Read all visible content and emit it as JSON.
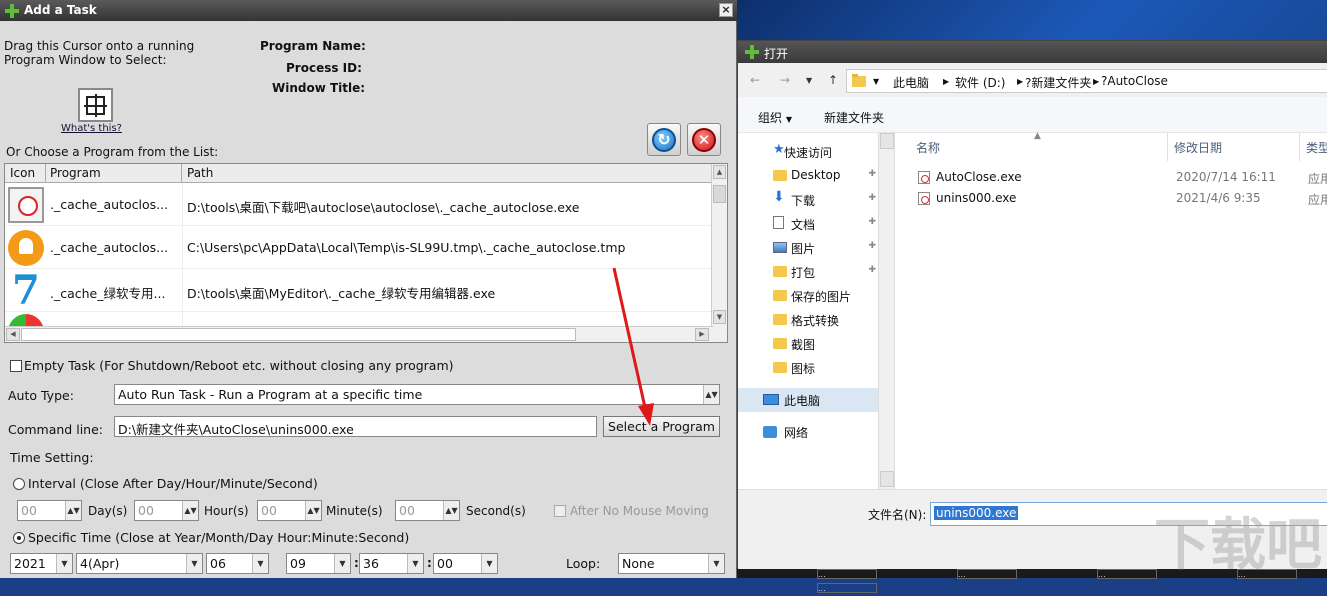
{
  "desktop": {
    "taskbar_items": [
      "...",
      "...",
      "...",
      "...",
      "..."
    ]
  },
  "add_task": {
    "title": "Add a Task",
    "drag_hint_line1": "Drag this Cursor onto a running",
    "drag_hint_line2": "Program Window to Select:",
    "whats_this": "What's this?",
    "program_name_label": "Program Name:",
    "process_id_label": "Process ID:",
    "window_title_label": "Window Title:",
    "choose_label": "Or Choose a Program from the List:",
    "columns": {
      "icon": "Icon",
      "program": "Program",
      "path": "Path"
    },
    "programs": [
      {
        "icon": "clock-icon",
        "name": "._cache_autoclos...",
        "path": "D:\\tools\\桌面\\下载吧\\autoclose\\autoclose\\._cache_autoclose.exe"
      },
      {
        "icon": "bell-icon",
        "name": "._cache_autoclos...",
        "path": "C:\\Users\\pc\\AppData\\Local\\Temp\\is-SL99U.tmp\\._cache_autoclose.tmp"
      },
      {
        "icon": "seven-icon",
        "name": "._cache_绿软专用...",
        "path": "D:\\tools\\桌面\\MyEditor\\._cache_绿软专用编辑器.exe"
      }
    ],
    "empty_task_label": "Empty Task (For Shutdown/Reboot etc. without closing any program)",
    "auto_type_label": "Auto Type:",
    "auto_type_value": "Auto Run Task - Run a Program at a specific time",
    "command_line_label": "Command line:",
    "command_line_value": "D:\\新建文件夹\\AutoClose\\unins000.exe",
    "select_program_button": "Select a Program",
    "time_setting_label": "Time Setting:",
    "interval_label": "Interval (Close After Day/Hour/Minute/Second)",
    "interval": {
      "days": "00",
      "hours": "00",
      "minutes": "00",
      "seconds": "00"
    },
    "days_label": "Day(s)",
    "hours_label": "Hour(s)",
    "minutes_label": "Minute(s)",
    "seconds_label": "Second(s)",
    "after_no_mouse_label": "After No Mouse Moving",
    "specific_time_label": "Specific Time (Close at Year/Month/Day Hour:Minute:Second)",
    "specific": {
      "year": "2021",
      "month": "4(Apr)",
      "day": "06",
      "hour": "09",
      "minute": "36",
      "second": "00"
    },
    "colon": ":",
    "loop_label": "Loop:",
    "loop_value": "None"
  },
  "open_dialog": {
    "title": "打开",
    "breadcrumbs": [
      "此电脑",
      "软件 (D:)",
      "?新建文件夹",
      "?AutoClose"
    ],
    "toolbar": {
      "organize": "组织",
      "new_folder": "新建文件夹"
    },
    "nav": [
      {
        "label": "快速访问",
        "icon": "star-icon",
        "pinned": false
      },
      {
        "label": "Desktop",
        "icon": "folder-icon",
        "pinned": true
      },
      {
        "label": "下载",
        "icon": "download-icon",
        "pinned": true
      },
      {
        "label": "文档",
        "icon": "document-icon",
        "pinned": true
      },
      {
        "label": "图片",
        "icon": "picture-icon",
        "pinned": true
      },
      {
        "label": "打包",
        "icon": "folder-icon",
        "pinned": true
      },
      {
        "label": "保存的图片",
        "icon": "folder-icon",
        "pinned": false
      },
      {
        "label": "格式转换",
        "icon": "folder-icon",
        "pinned": false
      },
      {
        "label": "截图",
        "icon": "folder-icon",
        "pinned": false
      },
      {
        "label": "图标",
        "icon": "folder-icon",
        "pinned": false
      },
      {
        "label": "此电脑",
        "icon": "computer-icon",
        "pinned": false
      },
      {
        "label": "网络",
        "icon": "network-icon",
        "pinned": false
      }
    ],
    "columns": {
      "name": "名称",
      "modified": "修改日期",
      "type": "类型"
    },
    "files": [
      {
        "name": "AutoClose.exe",
        "modified": "2020/7/14 16:11",
        "type": "应用程"
      },
      {
        "name": "unins000.exe",
        "modified": "2021/4/6 9:35",
        "type": "应用程"
      }
    ],
    "filename_label": "文件名(N):",
    "filename_value": "unins000.exe"
  },
  "colors": {
    "accent_blue": "#2f78d2",
    "arrow_red": "#e01818",
    "title_dark": "#3a3a3a"
  }
}
